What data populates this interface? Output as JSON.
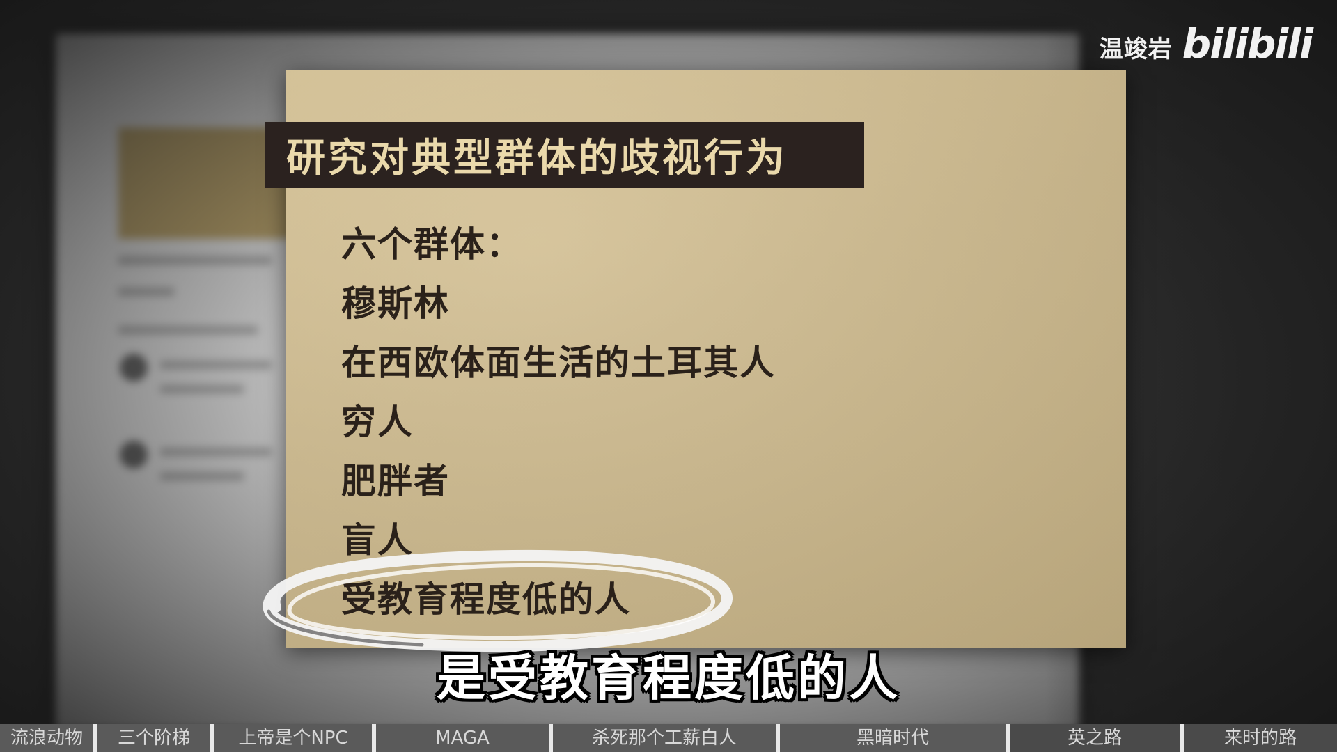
{
  "watermark": {
    "author": "温竣岩",
    "brand": "bilibili"
  },
  "card": {
    "title": "研究对典型群体的歧视行为",
    "items": [
      "六个群体：",
      "穆斯林",
      "在西欧体面生活的土耳其人",
      "穷人",
      "肥胖者",
      "盲人",
      "受教育程度低的人"
    ]
  },
  "subtitle": "是受教育程度低的人",
  "chapters": [
    {
      "label": "流浪动物"
    },
    {
      "label": "三个阶梯"
    },
    {
      "label": "上帝是个NPC"
    },
    {
      "label": "MAGA"
    },
    {
      "label": "杀死那个工薪白人"
    },
    {
      "label": "黑暗时代"
    },
    {
      "label": "英之路"
    },
    {
      "label": "来时的路"
    }
  ],
  "colors": {
    "card": "#cdb98c",
    "title_bar": "#2b221f",
    "title_text": "#ead9ab"
  }
}
